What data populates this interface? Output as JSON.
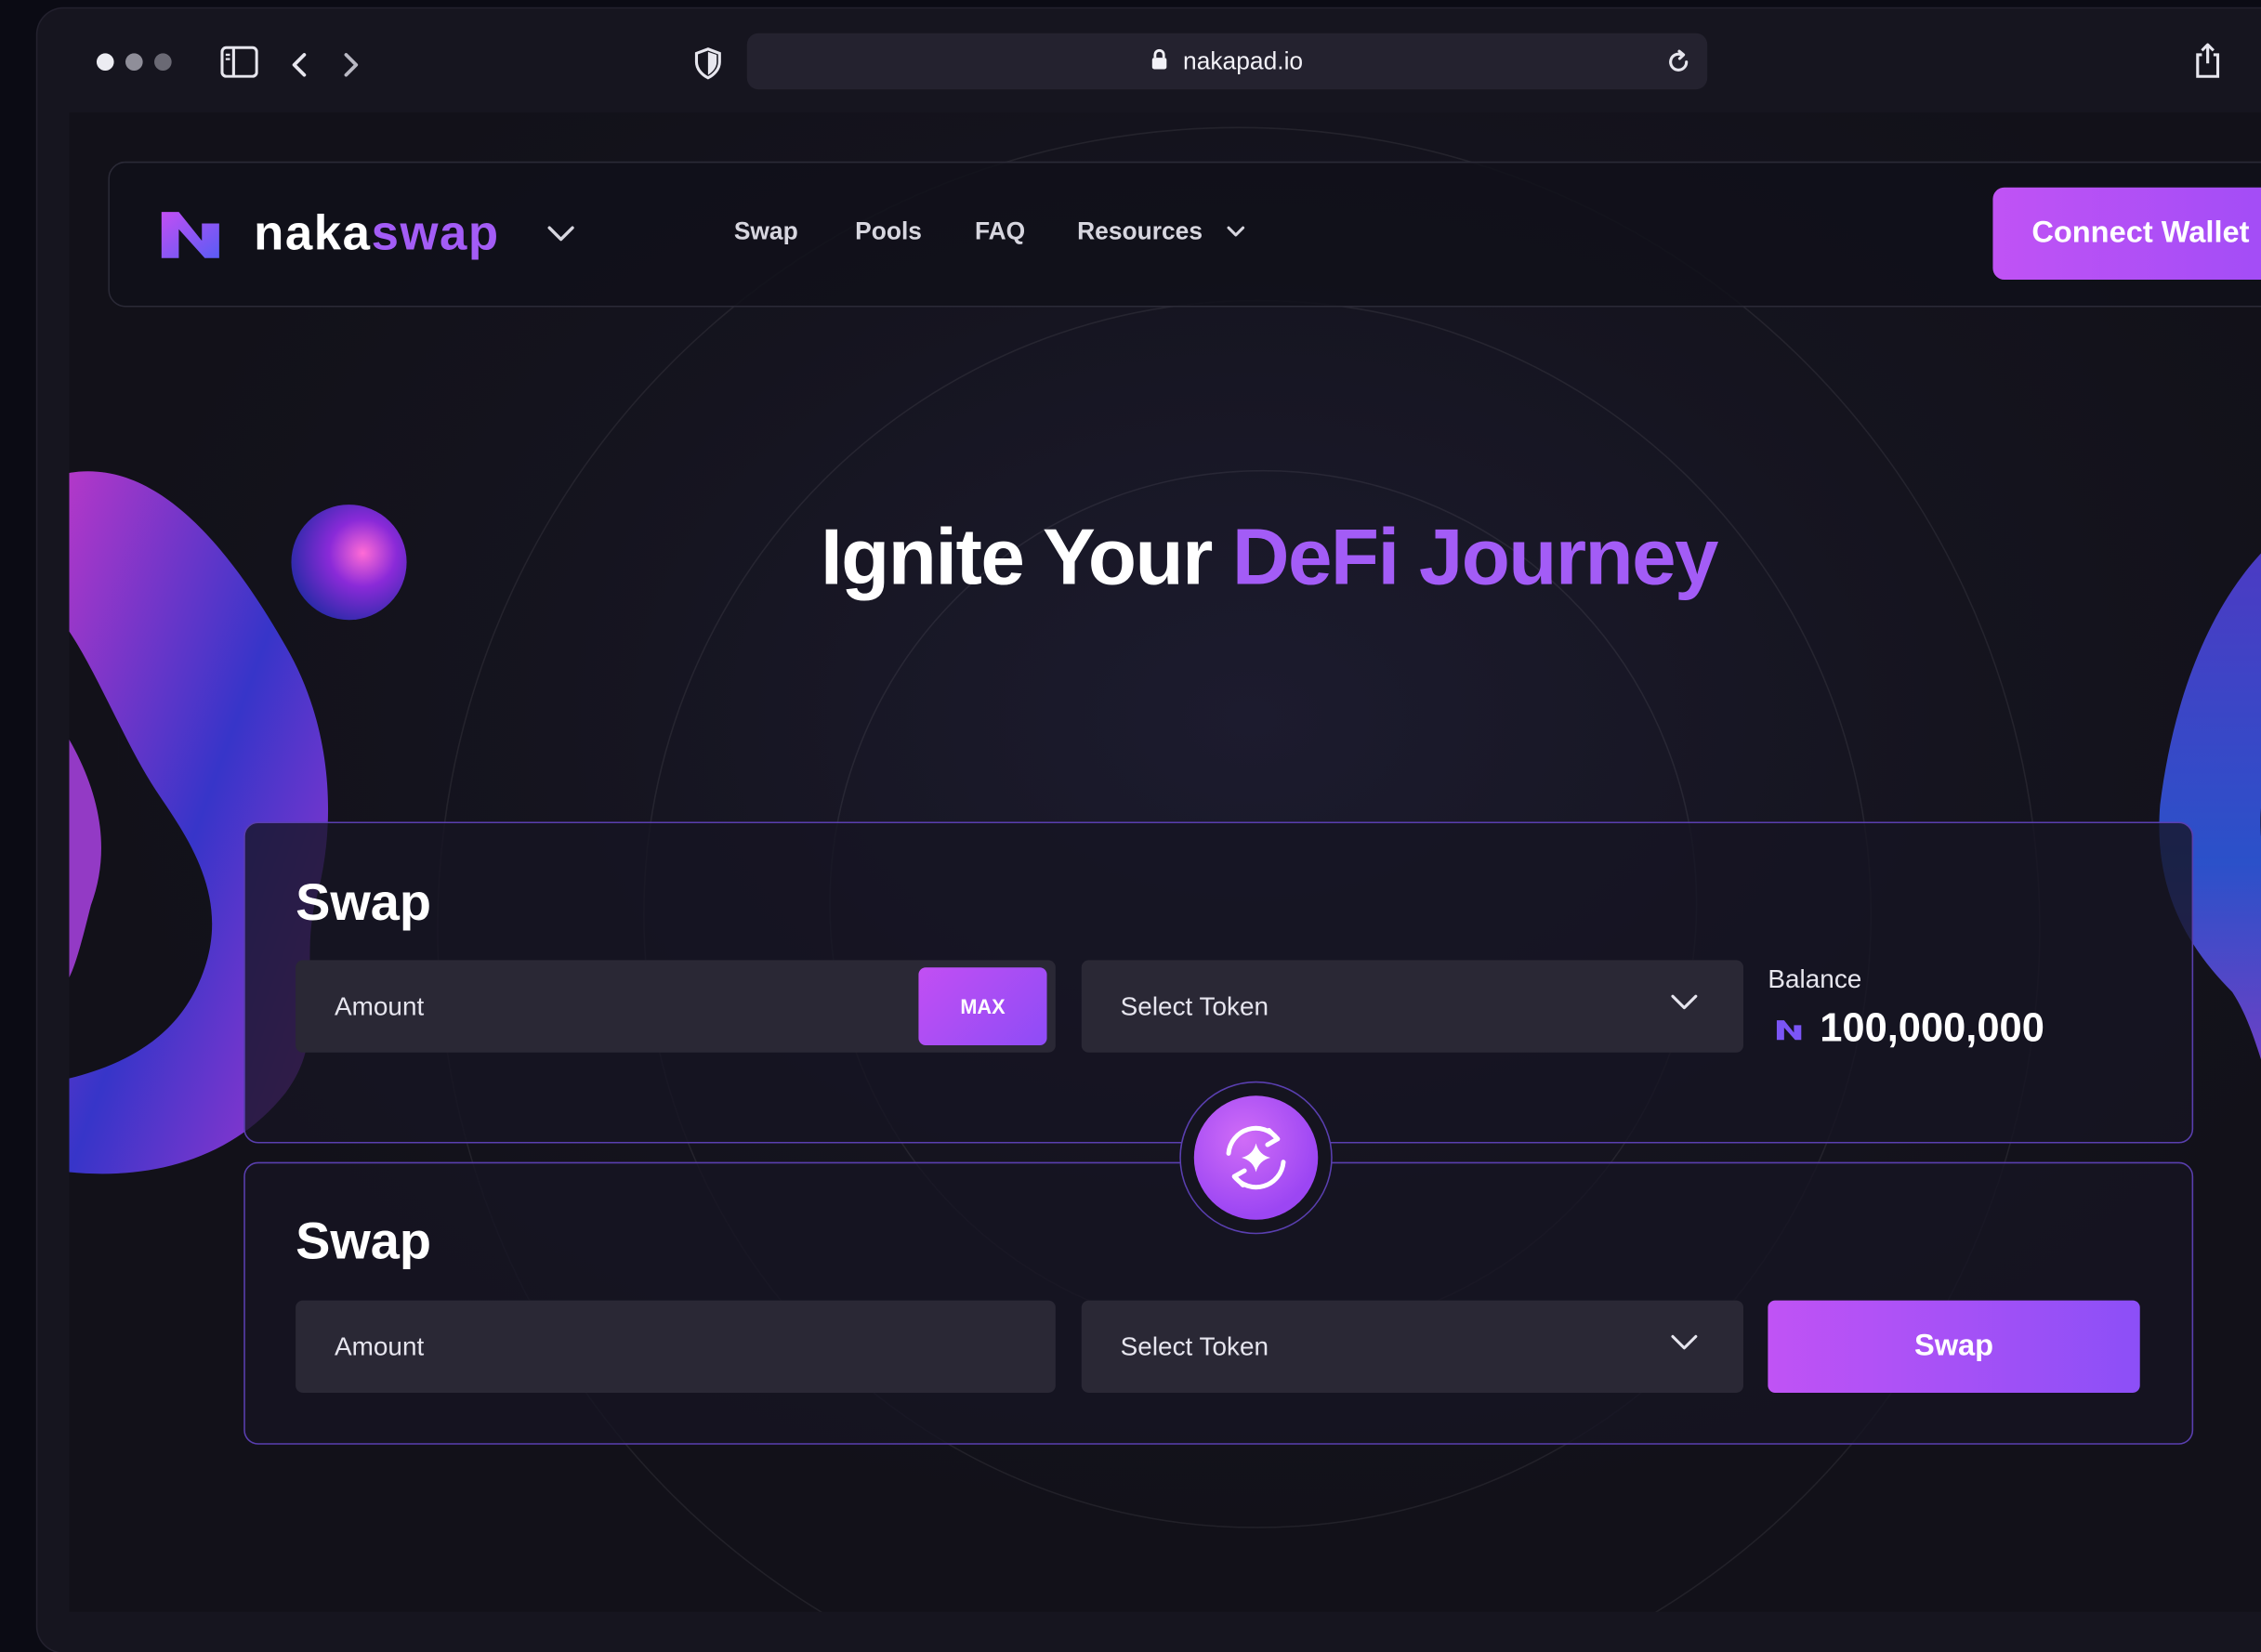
{
  "browser": {
    "url": "nakapad.io",
    "traffic_light_colors": [
      "#ececf2",
      "#8f8e99",
      "#6a6974"
    ]
  },
  "nav": {
    "brand_prefix": "naka",
    "brand_suffix": "swap",
    "links": [
      "Swap",
      "Pools",
      "FAQ",
      "Resources"
    ],
    "connect_label": "Connect Wallet"
  },
  "hero": {
    "title_plain": "Ignite Your ",
    "title_accent": "DeFi Journey"
  },
  "swap_from": {
    "title": "Swap",
    "amount_placeholder": "Amount",
    "max_label": "MAX",
    "token_label": "Select Token",
    "balance_label": "Balance",
    "balance_value": "100,000,000"
  },
  "swap_to": {
    "title": "Swap",
    "amount_placeholder": "Amount",
    "token_label": "Select Token",
    "swap_label": "Swap"
  },
  "icons": {
    "switch": "swap-arrows-sparkle-icon",
    "balance_token": "nakaswap-logo-icon"
  },
  "colors": {
    "accent": "#a35cf6",
    "button_gradient_start": "#c053f5",
    "button_gradient_end": "#8c4ff7",
    "card_border": "#5a3fb0"
  }
}
